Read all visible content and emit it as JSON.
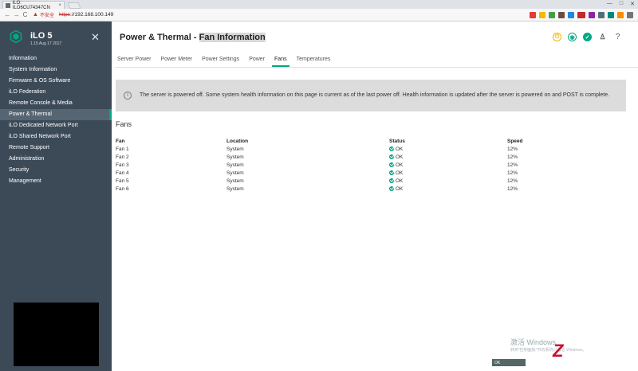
{
  "browser": {
    "tab_title": "iLO: ILO6CU74347CN",
    "tab_close": "×",
    "security_label": "不安全",
    "url_proto": "https",
    "url_host": "://192.168.100.149",
    "back": "←",
    "forward": "→",
    "reload": "C",
    "min": "—",
    "max": "□",
    "close": "✕"
  },
  "sidebar": {
    "product": "iLO 5",
    "version": "1.15 Aug 17 2017",
    "close": "✕",
    "items": [
      {
        "label": "Information"
      },
      {
        "label": "System Information"
      },
      {
        "label": "Firmware & OS Software"
      },
      {
        "label": "iLO Federation"
      },
      {
        "label": "Remote Console & Media"
      },
      {
        "label": "Power & Thermal"
      },
      {
        "label": "iLO Dedicated Network Port"
      },
      {
        "label": "iLO Shared Network Port"
      },
      {
        "label": "Remote Support"
      },
      {
        "label": "Administration"
      },
      {
        "label": "Security"
      },
      {
        "label": "Management"
      }
    ]
  },
  "header": {
    "title_main": "Power & Thermal - ",
    "title_hl": "Fan Information",
    "help": "?"
  },
  "tabs": [
    "Server Power",
    "Power Meter",
    "Power Settings",
    "Power",
    "Fans",
    "Temperatures"
  ],
  "notice": {
    "icon": "i",
    "text": "The server is powered off. Some system health information on this page is current as of the last power off. Health information is updated after the server is powered on and POST is complete."
  },
  "fans": {
    "section_title": "Fans",
    "columns": [
      "Fan",
      "Location",
      "Status",
      "Speed"
    ],
    "rows": [
      {
        "fan": "Fan 1",
        "location": "System",
        "status": "OK",
        "speed": "12%"
      },
      {
        "fan": "Fan 2",
        "location": "System",
        "status": "OK",
        "speed": "12%"
      },
      {
        "fan": "Fan 3",
        "location": "System",
        "status": "OK",
        "speed": "12%"
      },
      {
        "fan": "Fan 4",
        "location": "System",
        "status": "OK",
        "speed": "12%"
      },
      {
        "fan": "Fan 5",
        "location": "System",
        "status": "OK",
        "speed": "12%"
      },
      {
        "fan": "Fan 6",
        "location": "System",
        "status": "OK",
        "speed": "12%"
      }
    ]
  },
  "watermark": {
    "title": "激活 Windows",
    "sub": "转到\"控制面板\"中的系统以激活 Windows。"
  },
  "taskbar": {
    "label": "OK"
  },
  "colors": {
    "accent": "#01a982",
    "sidebar": "#3c4a58",
    "power": "#f0b400",
    "status_ok": "#01a982"
  }
}
